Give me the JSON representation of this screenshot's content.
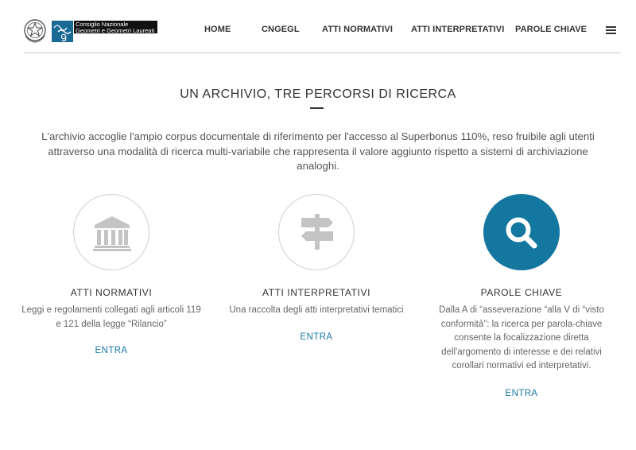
{
  "header": {
    "logo_line1": "Consiglio Nazionale",
    "logo_line2": "Geometri e Geometri Laureati",
    "nav": [
      {
        "label": "HOME"
      },
      {
        "label": "CNGEGL"
      },
      {
        "label": "ATTI NORMATIVI"
      },
      {
        "label": "ATTI INTERPRETATIVI"
      },
      {
        "label": "PAROLE CHIAVE"
      }
    ],
    "menu_icon": "hamburger-icon"
  },
  "main": {
    "title": "UN ARCHIVIO, TRE PERCORSI DI RICERCA",
    "intro": "L'archivio accoglie l'ampio corpus documentale di riferimento per l'accesso al Superbonus 110%, reso fruibile agli utenti attraverso una modalità di ricerca multi-variabile che rappresenta il valore aggiunto rispetto a sistemi di archiviazione analoghi.",
    "columns": [
      {
        "icon": "bank-icon",
        "title": "ATTI NORMATIVI",
        "description": "Leggi e regolamenti collegati agli articoli 119 e 121 della legge “Rilancio”",
        "link": "ENTRA"
      },
      {
        "icon": "signpost-icon",
        "title": "ATTI INTERPRETATIVI",
        "description": "Una raccolta degli atti interpretativi tematici",
        "link": "ENTRA"
      },
      {
        "icon": "search-icon",
        "title": "PAROLE CHIAVE",
        "description": "Dalla A di “asseverazione “alla V di “visto conformità”: la ricerca per parola-chiave consente la focalizzazione diretta dell'argomento di interesse e dei relativi corollari normativi ed interpretativi.",
        "link": "ENTRA"
      }
    ]
  },
  "colors": {
    "accent": "#1477a0",
    "link": "#1a7aa6",
    "circle_border": "#cfcfcf",
    "icon_grey": "#c4c4c4"
  }
}
